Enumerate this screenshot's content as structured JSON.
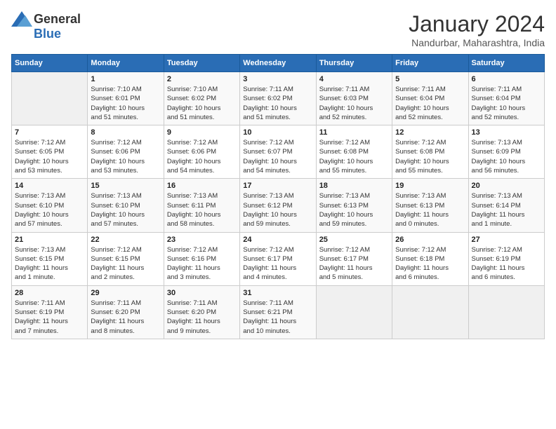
{
  "logo": {
    "general": "General",
    "blue": "Blue"
  },
  "title": "January 2024",
  "location": "Nandurbar, Maharashtra, India",
  "days_of_week": [
    "Sunday",
    "Monday",
    "Tuesday",
    "Wednesday",
    "Thursday",
    "Friday",
    "Saturday"
  ],
  "weeks": [
    [
      {
        "day": "",
        "info": ""
      },
      {
        "day": "1",
        "info": "Sunrise: 7:10 AM\nSunset: 6:01 PM\nDaylight: 10 hours\nand 51 minutes."
      },
      {
        "day": "2",
        "info": "Sunrise: 7:10 AM\nSunset: 6:02 PM\nDaylight: 10 hours\nand 51 minutes."
      },
      {
        "day": "3",
        "info": "Sunrise: 7:11 AM\nSunset: 6:02 PM\nDaylight: 10 hours\nand 51 minutes."
      },
      {
        "day": "4",
        "info": "Sunrise: 7:11 AM\nSunset: 6:03 PM\nDaylight: 10 hours\nand 52 minutes."
      },
      {
        "day": "5",
        "info": "Sunrise: 7:11 AM\nSunset: 6:04 PM\nDaylight: 10 hours\nand 52 minutes."
      },
      {
        "day": "6",
        "info": "Sunrise: 7:11 AM\nSunset: 6:04 PM\nDaylight: 10 hours\nand 52 minutes."
      }
    ],
    [
      {
        "day": "7",
        "info": "Sunrise: 7:12 AM\nSunset: 6:05 PM\nDaylight: 10 hours\nand 53 minutes."
      },
      {
        "day": "8",
        "info": "Sunrise: 7:12 AM\nSunset: 6:06 PM\nDaylight: 10 hours\nand 53 minutes."
      },
      {
        "day": "9",
        "info": "Sunrise: 7:12 AM\nSunset: 6:06 PM\nDaylight: 10 hours\nand 54 minutes."
      },
      {
        "day": "10",
        "info": "Sunrise: 7:12 AM\nSunset: 6:07 PM\nDaylight: 10 hours\nand 54 minutes."
      },
      {
        "day": "11",
        "info": "Sunrise: 7:12 AM\nSunset: 6:08 PM\nDaylight: 10 hours\nand 55 minutes."
      },
      {
        "day": "12",
        "info": "Sunrise: 7:12 AM\nSunset: 6:08 PM\nDaylight: 10 hours\nand 55 minutes."
      },
      {
        "day": "13",
        "info": "Sunrise: 7:13 AM\nSunset: 6:09 PM\nDaylight: 10 hours\nand 56 minutes."
      }
    ],
    [
      {
        "day": "14",
        "info": "Sunrise: 7:13 AM\nSunset: 6:10 PM\nDaylight: 10 hours\nand 57 minutes."
      },
      {
        "day": "15",
        "info": "Sunrise: 7:13 AM\nSunset: 6:10 PM\nDaylight: 10 hours\nand 57 minutes."
      },
      {
        "day": "16",
        "info": "Sunrise: 7:13 AM\nSunset: 6:11 PM\nDaylight: 10 hours\nand 58 minutes."
      },
      {
        "day": "17",
        "info": "Sunrise: 7:13 AM\nSunset: 6:12 PM\nDaylight: 10 hours\nand 59 minutes."
      },
      {
        "day": "18",
        "info": "Sunrise: 7:13 AM\nSunset: 6:13 PM\nDaylight: 10 hours\nand 59 minutes."
      },
      {
        "day": "19",
        "info": "Sunrise: 7:13 AM\nSunset: 6:13 PM\nDaylight: 11 hours\nand 0 minutes."
      },
      {
        "day": "20",
        "info": "Sunrise: 7:13 AM\nSunset: 6:14 PM\nDaylight: 11 hours\nand 1 minute."
      }
    ],
    [
      {
        "day": "21",
        "info": "Sunrise: 7:13 AM\nSunset: 6:15 PM\nDaylight: 11 hours\nand 1 minute."
      },
      {
        "day": "22",
        "info": "Sunrise: 7:12 AM\nSunset: 6:15 PM\nDaylight: 11 hours\nand 2 minutes."
      },
      {
        "day": "23",
        "info": "Sunrise: 7:12 AM\nSunset: 6:16 PM\nDaylight: 11 hours\nand 3 minutes."
      },
      {
        "day": "24",
        "info": "Sunrise: 7:12 AM\nSunset: 6:17 PM\nDaylight: 11 hours\nand 4 minutes."
      },
      {
        "day": "25",
        "info": "Sunrise: 7:12 AM\nSunset: 6:17 PM\nDaylight: 11 hours\nand 5 minutes."
      },
      {
        "day": "26",
        "info": "Sunrise: 7:12 AM\nSunset: 6:18 PM\nDaylight: 11 hours\nand 6 minutes."
      },
      {
        "day": "27",
        "info": "Sunrise: 7:12 AM\nSunset: 6:19 PM\nDaylight: 11 hours\nand 6 minutes."
      }
    ],
    [
      {
        "day": "28",
        "info": "Sunrise: 7:11 AM\nSunset: 6:19 PM\nDaylight: 11 hours\nand 7 minutes."
      },
      {
        "day": "29",
        "info": "Sunrise: 7:11 AM\nSunset: 6:20 PM\nDaylight: 11 hours\nand 8 minutes."
      },
      {
        "day": "30",
        "info": "Sunrise: 7:11 AM\nSunset: 6:20 PM\nDaylight: 11 hours\nand 9 minutes."
      },
      {
        "day": "31",
        "info": "Sunrise: 7:11 AM\nSunset: 6:21 PM\nDaylight: 11 hours\nand 10 minutes."
      },
      {
        "day": "",
        "info": ""
      },
      {
        "day": "",
        "info": ""
      },
      {
        "day": "",
        "info": ""
      }
    ]
  ]
}
